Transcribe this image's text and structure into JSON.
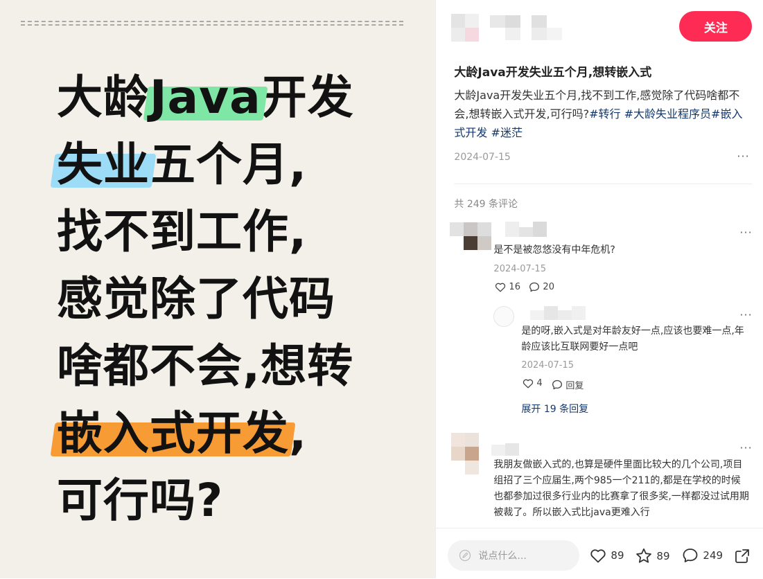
{
  "poster": {
    "lines": [
      {
        "a": "大龄",
        "hl": "Java",
        "b": "开发"
      },
      {
        "hl": "失业",
        "b": "五个月,"
      },
      {
        "b": "找不到工作,"
      },
      {
        "b": "感觉除了代码"
      },
      {
        "b": "啥都不会,想转"
      },
      {
        "hl": "嵌入式开发",
        "b": ","
      },
      {
        "b": "可行吗?"
      }
    ],
    "highlight_colors": {
      "green": "#7fe7a5",
      "blue": "#9ddcf7",
      "orange": "#f79b35"
    }
  },
  "header": {
    "follow_label": "关注",
    "follow_color": "#fe2c55"
  },
  "post": {
    "title": "大龄Java开发失业五个月,想转嵌入式",
    "body": "大龄Java开发失业五个月,找不到工作,感觉除了代码啥都不会,想转嵌入式开发,可行吗?",
    "tags": [
      "#转行",
      "#大龄失业程序员",
      "#嵌入式开发",
      "#迷茫"
    ],
    "date": "2024-07-15",
    "more": "···"
  },
  "comments": {
    "count_label": "共 249 条评论",
    "items": [
      {
        "text": "是不是被忽悠没有中年危机?",
        "date": "2024-07-15",
        "likes": "16",
        "replies": "20",
        "sub": {
          "text": "是的呀,嵌入式是对年龄友好一点,应该也要难一点,年龄应该比互联网要好一点吧",
          "date": "2024-07-15",
          "likes": "4",
          "reply_label": "回复"
        },
        "expand_label": "展开 19 条回复"
      },
      {
        "text": "我朋友做嵌入式的,也算是硬件里面比较大的几个公司,项目组招了三个应届生,两个985一个211的,都是在学校的时候也都参加过很多行业内的比赛拿了很多奖,一样都没过试用期被裁了。所以嵌入式比java更难入行"
      }
    ]
  },
  "bottom_bar": {
    "input_placeholder": "说点什么...",
    "likes": "89",
    "collects": "89",
    "comments": "249"
  }
}
